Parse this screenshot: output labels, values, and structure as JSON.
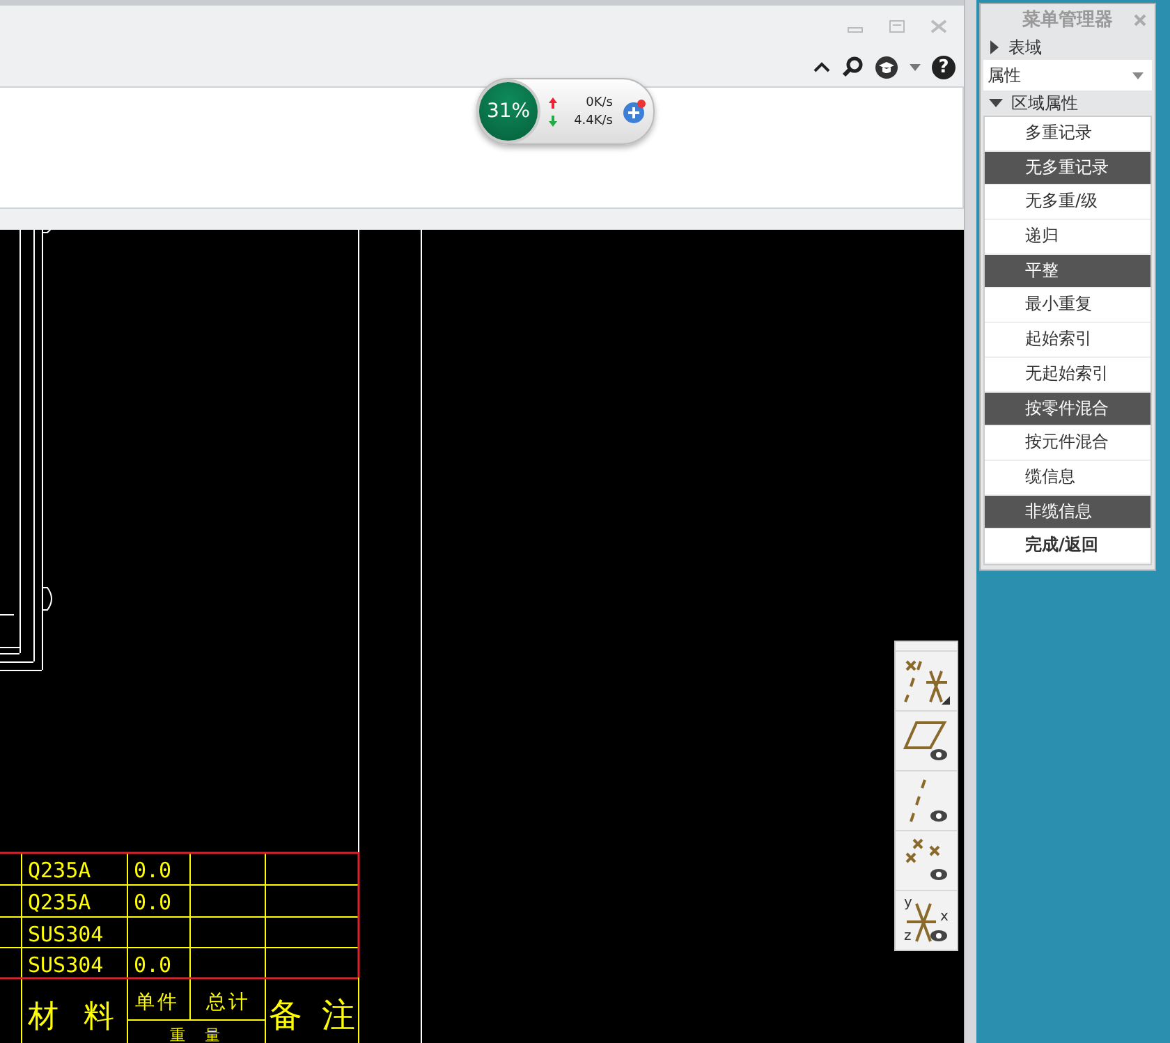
{
  "toolbar": {
    "help_label": "?"
  },
  "speed_widget": {
    "percent": "31%",
    "upload": "0K/s",
    "download": "4.4K/s"
  },
  "cad_table": {
    "rows": [
      {
        "material": "Q235A",
        "unit_weight": "0.0"
      },
      {
        "material": "Q235A",
        "unit_weight": "0.0"
      },
      {
        "material": "SUS304"
      },
      {
        "material": "SUS304",
        "unit_weight": "0.0"
      }
    ],
    "headers": {
      "material": "材料",
      "unit": "单件",
      "total": "总计",
      "weight": "重量",
      "remarks": "备注"
    }
  },
  "view_toolbar": {
    "buttons": [
      {
        "kind": "datum-display"
      },
      {
        "kind": "plane"
      },
      {
        "kind": "axis"
      },
      {
        "kind": "point"
      },
      {
        "kind": "csys",
        "labels": [
          "y",
          "x",
          "z"
        ]
      }
    ]
  },
  "menu_manager": {
    "title": "菜单管理器",
    "table_field": {
      "label": "表域",
      "expanded": false
    },
    "dropdown": {
      "value": "属性"
    },
    "region_attributes": {
      "label": "区域属性",
      "expanded": true,
      "items": [
        {
          "label": "多重记录",
          "kind": "option",
          "selected": false
        },
        {
          "label": "无多重记录",
          "kind": "option",
          "selected": true
        },
        {
          "label": "无多重/级",
          "kind": "option",
          "selected": false
        },
        {
          "label": "递归",
          "kind": "option",
          "selected": false
        },
        {
          "label": "平整",
          "kind": "option",
          "selected": true
        },
        {
          "label": "最小重复",
          "kind": "option",
          "selected": false
        },
        {
          "label": "起始索引",
          "kind": "option",
          "selected": false
        },
        {
          "label": "无起始索引",
          "kind": "option",
          "selected": false
        },
        {
          "label": "按零件混合",
          "kind": "option",
          "selected": true
        },
        {
          "label": "按元件混合",
          "kind": "option",
          "selected": false
        },
        {
          "label": "缆信息",
          "kind": "option",
          "selected": false
        },
        {
          "label": "非缆信息",
          "kind": "option",
          "selected": true
        },
        {
          "label": "完成/返回",
          "kind": "action",
          "selected": false
        }
      ]
    }
  }
}
